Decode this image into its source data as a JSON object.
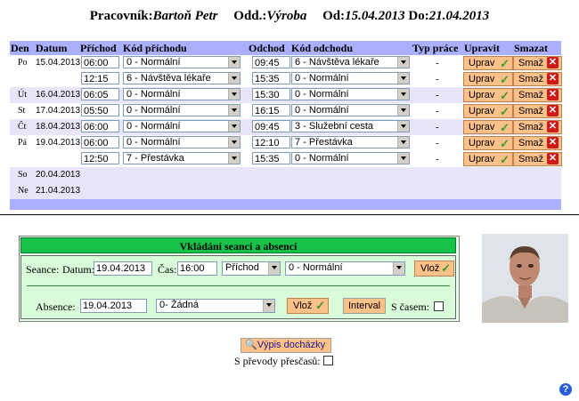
{
  "header": {
    "pracovnik_label": "Pracovník:",
    "pracovnik_value": "Bartoň Petr",
    "odd_label": "Odd.:",
    "odd_value": "Výroba",
    "od_label": "Od:",
    "od_value": "15.04.2013",
    "do_label": "Do:",
    "do_value": "21.04.2013"
  },
  "table": {
    "columns": {
      "den": "Den",
      "datum": "Datum",
      "prichod": "Příchod",
      "kod_prichodu": "Kód příchodu",
      "odchod": "Odchod",
      "kod_odchodu": "Kód odchodu",
      "typ_prace": "Typ práce",
      "upravit": "Upravit",
      "smazat": "Smazat"
    },
    "rows": [
      {
        "den": "Po",
        "datum": "15.04.2013",
        "prichod": "06:00",
        "kod_prichodu": "0 - Normální",
        "odchod": "09:45",
        "kod_odchodu": "6 - Návštěva lékaře",
        "typ": "-",
        "upravit": "Uprav",
        "smazat": "Smaž"
      },
      {
        "den": "",
        "datum": "",
        "prichod": "12:15",
        "kod_prichodu": "6 - Návštěva lékaře",
        "odchod": "15:35",
        "kod_odchodu": "0 - Normální",
        "typ": "-",
        "upravit": "Uprav",
        "smazat": "Smaž"
      },
      {
        "den": "Út",
        "datum": "16.04.2013",
        "prichod": "06:05",
        "kod_prichodu": "0 - Normální",
        "odchod": "15:30",
        "kod_odchodu": "0 - Normální",
        "typ": "-",
        "upravit": "Uprav",
        "smazat": "Smaž"
      },
      {
        "den": "St",
        "datum": "17.04.2013",
        "prichod": "05:50",
        "kod_prichodu": "0 - Normální",
        "odchod": "16:15",
        "kod_odchodu": "0 - Normální",
        "typ": "-",
        "upravit": "Uprav",
        "smazat": "Smaž"
      },
      {
        "den": "Čt",
        "datum": "18.04.2013",
        "prichod": "06:00",
        "kod_prichodu": "0 - Normální",
        "odchod": "09:45",
        "kod_odchodu": "3 - Služební cesta",
        "typ": "-",
        "upravit": "Uprav",
        "smazat": "Smaž"
      },
      {
        "den": "Pá",
        "datum": "19.04.2013",
        "prichod": "06:00",
        "kod_prichodu": "0 - Normální",
        "odchod": "12:10",
        "kod_odchodu": "7 - Přestávka",
        "typ": "-",
        "upravit": "Uprav",
        "smazat": "Smaž"
      },
      {
        "den": "",
        "datum": "",
        "prichod": "12:50",
        "kod_prichodu": "7 - Přestávka",
        "odchod": "15:35",
        "kod_odchodu": "0 - Normální",
        "typ": "-",
        "upravit": "Uprav",
        "smazat": "Smaž"
      }
    ],
    "empty_days": [
      {
        "den": "So",
        "datum": "20.04.2013"
      },
      {
        "den": "Ne",
        "datum": "21.04.2013"
      }
    ]
  },
  "entry": {
    "title": "Vkládání seancí a absencí",
    "seance_label": "Seance:",
    "datum_label": "Datum:",
    "datum_value": "19.04.2013",
    "cas_label": "Čas:",
    "cas_value": "16:00",
    "direction_value": "Příchod",
    "code_value": "0 - Normální",
    "insert_label": "Vlož",
    "absence_label": "Absence:",
    "absence_date": "19.04.2013",
    "absence_code": "0- Žádná",
    "insert2_label": "Vlož",
    "interval_label": "Interval",
    "s_casem_label": "S časem:"
  },
  "footer": {
    "vypis_label": "Výpis docházky",
    "prevody_label": "S převody přesčasů:",
    "help_label": "?"
  },
  "colors": {
    "table_header": "#aab0ff",
    "row_alt": "#e6e6f8",
    "button": "#fcc089",
    "panel_title": "#17c24a",
    "panel_bg": "#d9fbd9"
  }
}
